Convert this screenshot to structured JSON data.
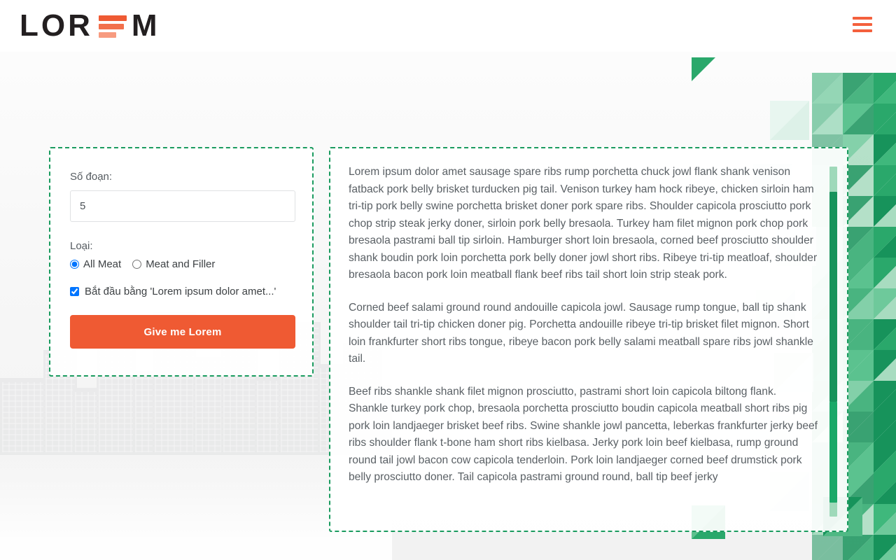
{
  "header": {
    "logo": {
      "text_before": "LOR",
      "letter_e": "E",
      "text_after": "M",
      "full": "LOREM"
    },
    "menu_icon": "hamburger-menu-icon"
  },
  "colors": {
    "brand_orange": "#ef5a33",
    "brand_orange_mid": "#f2704c",
    "brand_orange_light": "#f79b80",
    "accent_green": "#1a9b5f",
    "green_dark": "#17935b",
    "green_mid": "#2aa86b",
    "green_light": "#9fd9ba",
    "logo_dark": "#231f20",
    "body_text": "#5a6065"
  },
  "form": {
    "paragraphs_label": "Số đoạn:",
    "paragraphs_value": "5",
    "paragraphs_placeholder": "5",
    "type_label": "Loại:",
    "radio_options": [
      {
        "label": "All Meat",
        "checked": true
      },
      {
        "label": "Meat and Filler",
        "checked": false
      }
    ],
    "checkbox": {
      "label": "Bắt đầu bằng 'Lorem ipsum dolor amet...'",
      "checked": true
    },
    "submit_label": "Give me Lorem"
  },
  "output": {
    "paragraphs": [
      "Lorem ipsum dolor amet sausage spare ribs rump porchetta chuck jowl flank shank venison fatback pork belly brisket turducken pig tail. Venison turkey ham hock ribeye, chicken sirloin ham tri-tip pork belly swine porchetta brisket doner pork spare ribs. Shoulder capicola prosciutto pork chop strip steak jerky doner, sirloin pork belly bresaola. Turkey ham filet mignon pork chop pork bresaola pastrami ball tip sirloin. Hamburger short loin bresaola, corned beef prosciutto shoulder shank boudin pork loin porchetta pork belly doner jowl short ribs. Ribeye tri-tip meatloaf, shoulder bresaola bacon pork loin meatball flank beef ribs tail short loin strip steak pork.",
      "Corned beef salami ground round andouille capicola jowl. Sausage rump tongue, ball tip shank shoulder tail tri-tip chicken doner pig. Porchetta andouille ribeye tri-tip brisket filet mignon. Short loin frankfurter short ribs tongue, ribeye bacon pork belly salami meatball spare ribs jowl shankle tail.",
      "Beef ribs shankle shank filet mignon prosciutto, pastrami short loin capicola biltong flank. Shankle turkey pork chop, bresaola porchetta prosciutto boudin capicola meatball short ribs pig pork loin landjaeger brisket beef ribs. Swine shankle jowl pancetta, leberkas frankfurter jerky beef ribs shoulder flank t-bone ham short ribs kielbasa. Jerky pork loin beef kielbasa, rump ground round tail jowl bacon cow capicola tenderloin. Pork loin landjaeger corned beef drumstick pork belly prosciutto doner. Tail capicola pastrami ground round, ball tip beef jerky"
    ]
  }
}
